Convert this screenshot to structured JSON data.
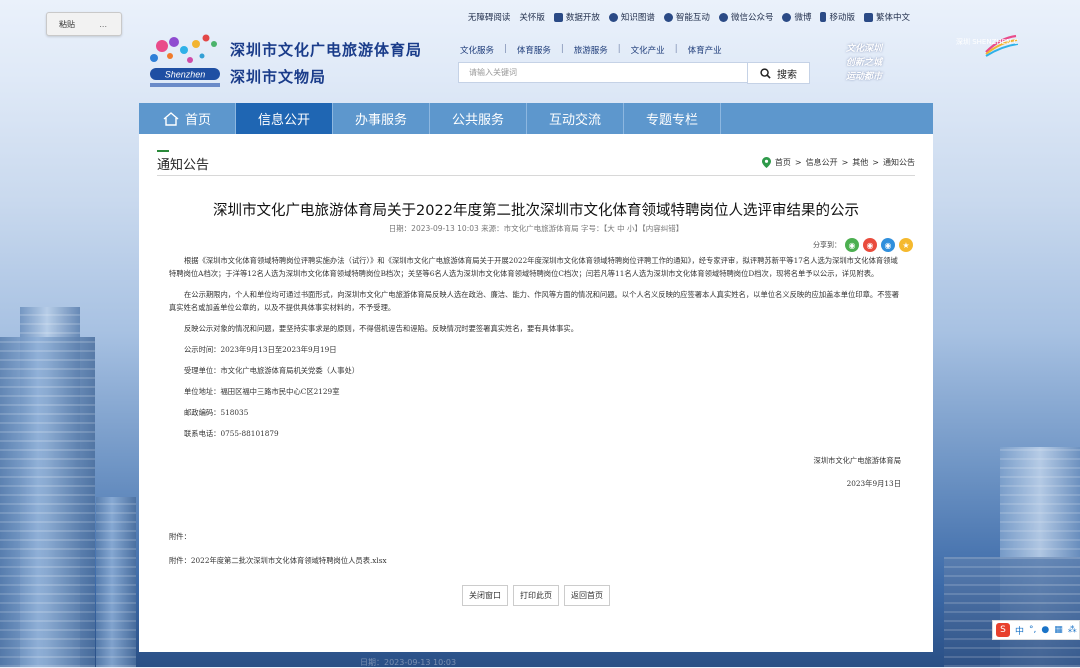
{
  "clipboard": {
    "paste": "粘贴",
    "more": "..."
  },
  "topbar": [
    "无障碍阅读",
    "关怀版",
    "数据开放",
    "知识图谱",
    "智能互动",
    "微信公众号",
    "微博",
    "移动版",
    "繁体中文"
  ],
  "header": {
    "bureau_name": "深圳市文化广电旅游体育局",
    "heritage_name": "深圳市文物局",
    "logo_text": "Shenzhen",
    "slogan": [
      "文化深圳",
      "创新之城",
      "运动都市"
    ],
    "brand": "深圳 SHENZHEN CHINA"
  },
  "catlinks": [
    "文化服务",
    "体育服务",
    "旅游服务",
    "文化产业",
    "体育产业"
  ],
  "search": {
    "placeholder": "请输入关键词",
    "button": "搜索"
  },
  "nav": [
    "首页",
    "信息公开",
    "办事服务",
    "公共服务",
    "互动交流",
    "专题专栏"
  ],
  "nav_active": 1,
  "section": {
    "title": "通知公告",
    "breadcrumb": [
      "首页",
      "信息公开",
      "其他",
      "通知公告"
    ]
  },
  "article": {
    "title": "深圳市文化广电旅游体育局关于2022年度第二批次深圳市文化体育领域特聘岗位人选评审结果的公示",
    "meta": "日期：2023-09-13 10:03  来源：市文化广电旅游体育局  字号：【大  中  小】【内容纠错】",
    "share_label": "分享到：",
    "paragraphs": [
      "根据《深圳市文化体育领域特聘岗位评聘实施办法（试行）》和《深圳市文化广电旅游体育局关于开展2022年度深圳市文化体育领域特聘岗位评聘工作的通知》，经专家评审，拟评聘苏新平等17名人选为深圳市文化体育领域特聘岗位A档次；于洋等12名人选为深圳市文化体育领域特聘岗位B档次；关坚等6名人选为深圳市文化体育领域特聘岗位C档次；闫若凡等11名人选为深圳市文化体育领域特聘岗位D档次，现将名单予以公示，详见附表。",
      "在公示期限内，个人和单位均可通过书面形式，向深圳市文化广电旅游体育局反映人选在政治、廉洁、能力、作风等方面的情况和问题。以个人名义反映的应签署本人真实姓名，以单位名义反映的应加盖本单位印章。不签署真实姓名或加盖单位公章的，以及不提供具体事实材料的，不予受理。",
      "反映公示对象的情况和问题，要坚持实事求是的原则，不得借机诬告和诬陷。反映情况时要签署真实姓名，要有具体事实。",
      "公示时间：2023年9月13日至2023年9月19日",
      "受理单位：市文化广电旅游体育局机关党委（人事处）",
      "单位地址：福田区福中三路市民中心C区2129室",
      "邮政编码：518035",
      "联系电话：0755-88101879"
    ],
    "signature": "深圳市文化广电旅游体育局",
    "date": "2023年9月13日",
    "attachment_label": "附件：",
    "attachment_file": "附件：2022年度第二批次深圳市文化体育领域特聘岗位人员表.xlsx"
  },
  "buttons": [
    "关闭窗口",
    "打印此页",
    "返回首页"
  ],
  "ime": {
    "logo": "S",
    "lang": "中"
  },
  "footer_hint": "日期：2023-09-13 10:03"
}
